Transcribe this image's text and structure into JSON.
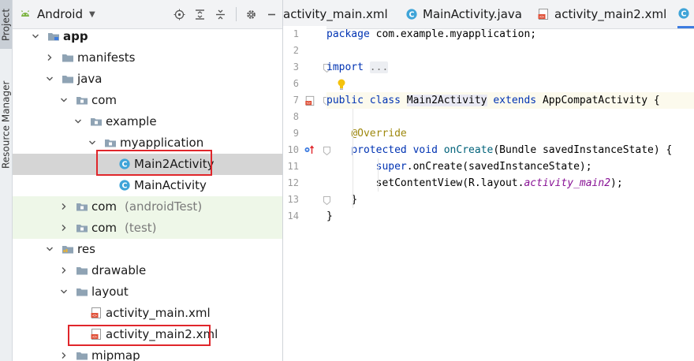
{
  "sidebar_strip": {
    "tabs": [
      {
        "label": "Project"
      },
      {
        "label": "Resource Manager"
      }
    ]
  },
  "project_panel": {
    "view_selector": "Android",
    "tools": [
      "target-icon",
      "collapse-all-icon",
      "expand-all-icon",
      "gear-icon"
    ],
    "tree": [
      {
        "label": "app",
        "suffix": "",
        "depth": 0,
        "expanded": true,
        "icon": "module-icon",
        "bold": true
      },
      {
        "label": "manifests",
        "suffix": "",
        "depth": 1,
        "expanded": false,
        "icon": "folder-icon"
      },
      {
        "label": "java",
        "suffix": "",
        "depth": 1,
        "expanded": true,
        "icon": "folder-icon"
      },
      {
        "label": "com",
        "suffix": "",
        "depth": 2,
        "expanded": true,
        "icon": "package-icon"
      },
      {
        "label": "example",
        "suffix": "",
        "depth": 3,
        "expanded": true,
        "icon": "package-icon"
      },
      {
        "label": "myapplication",
        "suffix": "",
        "depth": 4,
        "expanded": true,
        "icon": "package-icon"
      },
      {
        "label": "Main2Activity",
        "suffix": "",
        "depth": 5,
        "icon": "java-class-icon",
        "selected": true,
        "boxed": true
      },
      {
        "label": "MainActivity",
        "suffix": "",
        "depth": 5,
        "icon": "java-class-icon"
      },
      {
        "label": "com",
        "suffix": "(androidTest)",
        "depth": 2,
        "expanded": false,
        "icon": "package-icon",
        "test": true
      },
      {
        "label": "com",
        "suffix": "(test)",
        "depth": 2,
        "expanded": false,
        "icon": "package-icon",
        "test": true
      },
      {
        "label": "res",
        "suffix": "",
        "depth": 1,
        "expanded": true,
        "icon": "res-folder-icon"
      },
      {
        "label": "drawable",
        "suffix": "",
        "depth": 2,
        "expanded": false,
        "icon": "folder-icon"
      },
      {
        "label": "layout",
        "suffix": "",
        "depth": 2,
        "expanded": true,
        "icon": "folder-icon"
      },
      {
        "label": "activity_main.xml",
        "suffix": "",
        "depth": 3,
        "icon": "xml-file-icon"
      },
      {
        "label": "activity_main2.xml",
        "suffix": "",
        "depth": 3,
        "icon": "xml-file-icon",
        "boxed": true
      },
      {
        "label": "mipmap",
        "suffix": "",
        "depth": 2,
        "expanded": false,
        "icon": "folder-icon"
      }
    ]
  },
  "editor": {
    "tabs": [
      {
        "label": "activity_main.xml",
        "icon": "none"
      },
      {
        "label": "MainActivity.java",
        "icon": "java-class-icon"
      },
      {
        "label": "activity_main2.xml",
        "icon": "xml-file-icon"
      },
      {
        "label": "",
        "icon": "java-class-icon",
        "active": true
      }
    ],
    "line_numbers": [
      "1",
      "2",
      "3",
      "6",
      "7",
      "8",
      "9",
      "10",
      "11",
      "12",
      "13",
      "14"
    ],
    "code": {
      "l1_kw": "package",
      "l1_rest": " com.example.myapplication;",
      "l3_kw": "import",
      "l3_fold": "...",
      "l7_kw1": "public",
      "l7_kw2": "class",
      "l7_cls": "Main2Activity",
      "l7_kw3": "extends",
      "l7_rest": " AppCompatActivity {",
      "l9_ann": "@Override",
      "l10_kw1": "protected",
      "l10_kw2": "void",
      "l10_fn": "onCreate",
      "l10_rest": "(Bundle savedInstanceState) {",
      "l11_kw": "super",
      "l11_rest": ".onCreate(savedInstanceState);",
      "l12_a": "setContentView(R.layout.",
      "l12_fld": "activity_main2",
      "l12_b": ");",
      "l13": "}",
      "l14": "}"
    }
  },
  "colors": {
    "keyword": "#0033b3",
    "annotation": "#9e880d",
    "method": "#00627a",
    "field": "#871094",
    "highlight_box": "#e0262b",
    "java_icon": "#3fa4d8",
    "folder": "#8fa3b4"
  }
}
